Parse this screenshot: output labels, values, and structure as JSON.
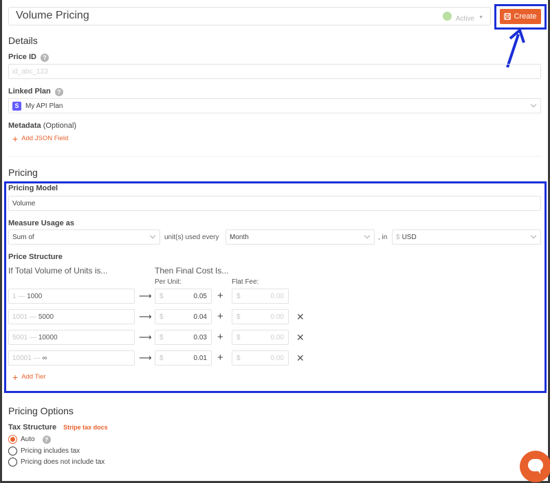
{
  "header": {
    "title": "Volume Pricing",
    "status": "Active",
    "create_label": "Create"
  },
  "details": {
    "heading": "Details",
    "price_id_label": "Price ID",
    "price_id_placeholder": "id_abc_123",
    "linked_plan_label": "Linked Plan",
    "linked_plan_badge": "S",
    "linked_plan_value": "My API Plan",
    "metadata_label": "Metadata",
    "metadata_optional": "(Optional)",
    "add_json_field": "Add JSON Field"
  },
  "pricing": {
    "heading": "Pricing",
    "model_label": "Pricing Model",
    "model_value": "Volume",
    "measure_label": "Measure Usage as",
    "measure_value": "Sum of",
    "units_text": "unit(s) used every",
    "period_value": "Month",
    "in_text": ", in",
    "currency_symbol": "$",
    "currency_value": "USD",
    "structure_label": "Price Structure",
    "if_total_text": "If Total Volume of Units is...",
    "then_cost_text": "Then Final Cost Is...",
    "per_unit_label": "Per Unit:",
    "flat_fee_label": "Flat Fee:",
    "dash": "—",
    "arrow": "⟶",
    "plus": "+",
    "x": "✕",
    "tiers": [
      {
        "from": "1",
        "to": "1000",
        "per_unit": "0.05",
        "flat": "0.00"
      },
      {
        "from": "1001",
        "to": "5000",
        "per_unit": "0.04",
        "flat": "0.00"
      },
      {
        "from": "5001",
        "to": "10000",
        "per_unit": "0.03",
        "flat": "0.00"
      },
      {
        "from": "10001",
        "to": "∞",
        "per_unit": "0.01",
        "flat": "0.00"
      }
    ],
    "add_tier": "Add Tier"
  },
  "options": {
    "heading": "Pricing Options",
    "tax_label": "Tax Structure",
    "stripe_link": "Stripe tax docs",
    "radios": [
      "Auto",
      "Pricing includes tax",
      "Pricing does not include tax"
    ]
  },
  "colors": {
    "accent": "#e8612c",
    "highlight": "#1a2fd8",
    "status_dot": "#b9dfa2"
  }
}
